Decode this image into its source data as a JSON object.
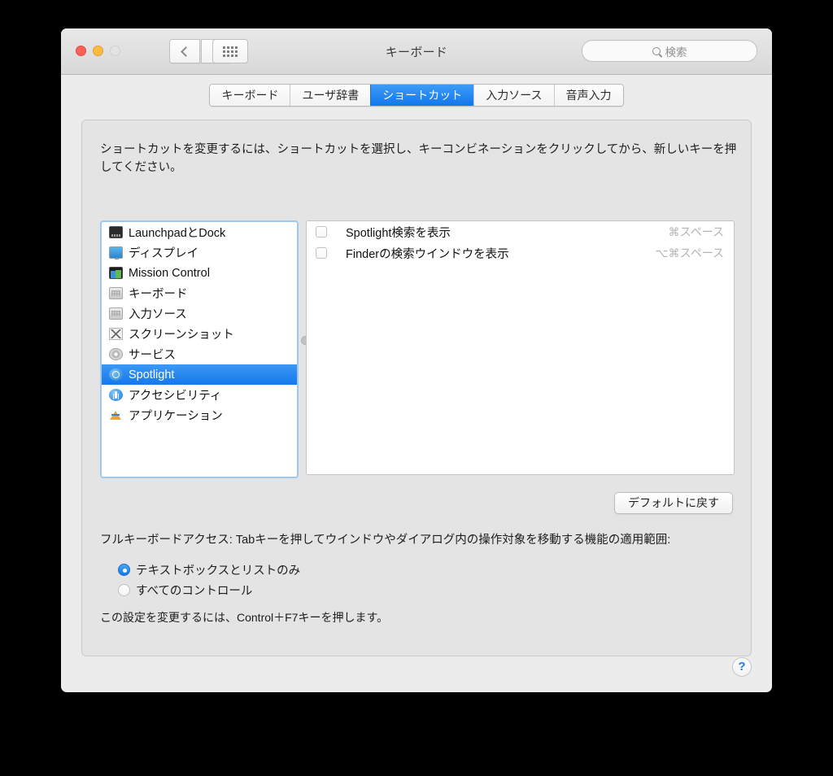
{
  "window": {
    "title": "キーボード",
    "traffic_lights": [
      "close",
      "minimize",
      "zoom"
    ],
    "search": {
      "placeholder": "検索",
      "value": ""
    },
    "nav": {
      "back": "‹",
      "forward": "›"
    }
  },
  "tabs": [
    {
      "label": "キーボード",
      "active": false
    },
    {
      "label": "ユーザ辞書",
      "active": false
    },
    {
      "label": "ショートカット",
      "active": true
    },
    {
      "label": "入力ソース",
      "active": false
    },
    {
      "label": "音声入力",
      "active": false
    }
  ],
  "instructions": "ショートカットを変更するには、ショートカットを選択し、キーコンビネーションをクリックしてから、新しいキーを押してください。",
  "categories": [
    {
      "label": "LaunchpadとDock",
      "icon": "launchpad-icon",
      "selected": false
    },
    {
      "label": "ディスプレイ",
      "icon": "display-icon",
      "selected": false
    },
    {
      "label": "Mission Control",
      "icon": "mission-control-icon",
      "selected": false
    },
    {
      "label": "キーボード",
      "icon": "keyboard-icon",
      "selected": false
    },
    {
      "label": "入力ソース",
      "icon": "input-source-icon",
      "selected": false
    },
    {
      "label": "スクリーンショット",
      "icon": "screenshot-icon",
      "selected": false
    },
    {
      "label": "サービス",
      "icon": "services-gear-icon",
      "selected": false
    },
    {
      "label": "Spotlight",
      "icon": "spotlight-icon",
      "selected": true
    },
    {
      "label": "アクセシビリティ",
      "icon": "accessibility-icon",
      "selected": false
    },
    {
      "label": "アプリケーション",
      "icon": "applications-icon",
      "selected": false
    }
  ],
  "shortcuts": [
    {
      "label": "Spotlight検索を表示",
      "keys": "⌘スペース",
      "checked": false
    },
    {
      "label": "Finderの検索ウインドウを表示",
      "keys": "⌥⌘スペース",
      "checked": false
    }
  ],
  "restore_button": "デフォルトに戻す",
  "full_keyboard_access": {
    "description": "フルキーボードアクセス: Tabキーを押してウインドウやダイアログ内の操作対象を移動する機能の適用範囲:",
    "options": [
      {
        "label": "テキストボックスとリストのみ",
        "selected": true
      },
      {
        "label": "すべてのコントロール",
        "selected": false
      }
    ],
    "note": "この設定を変更するには、Control＋F7キーを押します。"
  },
  "help_button": "?",
  "colors": {
    "accent": "#1278ec",
    "selection": "#1579ec",
    "window_bg": "#ececec",
    "panel_bg": "#e4e4e4",
    "list_bg": "#ffffff",
    "key_text": "#b4b4b4"
  }
}
